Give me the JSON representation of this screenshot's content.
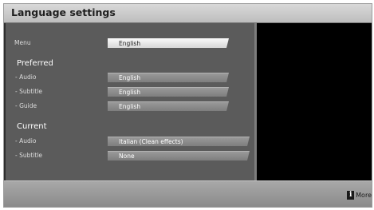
{
  "header": {
    "title": "Language settings"
  },
  "menu": {
    "label": "Menu",
    "value": "English"
  },
  "preferred": {
    "heading": "Preferred",
    "audio": {
      "label": "- Audio",
      "value": "English"
    },
    "subtitle": {
      "label": "- Subtitle",
      "value": "English"
    },
    "guide": {
      "label": "- Guide",
      "value": "English"
    }
  },
  "current": {
    "heading": "Current",
    "audio": {
      "label": "- Audio",
      "value": "Italian (Clean effects)"
    },
    "subtitle": {
      "label": "- Subtitle",
      "value": "None"
    }
  },
  "footer": {
    "more_label": "More",
    "more_icon": "info-icon"
  },
  "colors": {
    "selected_field": "#e8e8e8",
    "field": "#8c8c8c",
    "panel": "#5b5b5b",
    "preview": "#000000"
  }
}
